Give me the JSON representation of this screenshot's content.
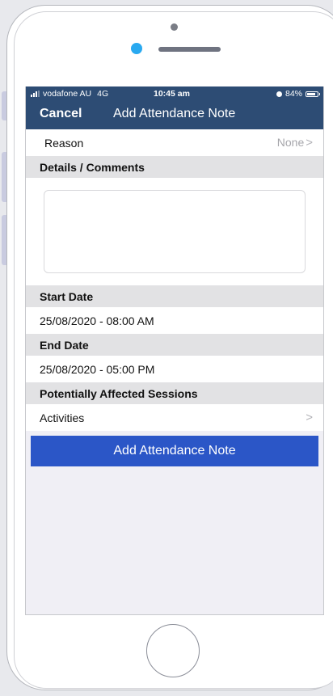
{
  "status_bar": {
    "carrier": "vodafone AU",
    "network": "4G",
    "time": "10:45 am",
    "battery": "84%",
    "battery_level": 0.84
  },
  "nav": {
    "cancel_label": "Cancel",
    "title": "Add Attendance Note"
  },
  "form": {
    "reason": {
      "label": "Reason",
      "value": "None",
      "chevron": ">"
    },
    "details": {
      "header": "Details / Comments",
      "value": "",
      "placeholder": ""
    },
    "start_date": {
      "header": "Start Date",
      "value": "25/08/2020 - 08:00 AM"
    },
    "end_date": {
      "header": "End Date",
      "value": "25/08/2020 - 05:00 PM"
    },
    "sessions": {
      "header": "Potentially Affected Sessions",
      "label": "Activities",
      "chevron": ">"
    }
  },
  "submit": {
    "label": "Add Attendance Note"
  },
  "colors": {
    "header_bg": "#2d4c74",
    "button_bg": "#2b56c7",
    "section_bg": "#e2e2e4",
    "screen_bg": "#f0eff5",
    "accent_dot": "#29a9f0"
  }
}
